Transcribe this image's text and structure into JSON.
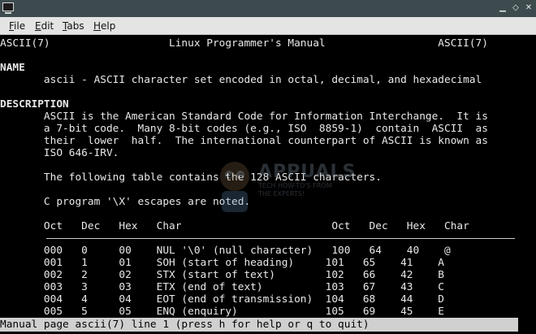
{
  "menubar": {
    "items": [
      {
        "mnemonic": "F",
        "rest": "ile"
      },
      {
        "mnemonic": "E",
        "rest": "dit"
      },
      {
        "mnemonic": "T",
        "rest": "abs"
      },
      {
        "mnemonic": "H",
        "rest": "elp"
      }
    ]
  },
  "titlebar": {
    "controls": [
      "▁",
      "◇",
      "✕"
    ]
  },
  "watermark": {
    "title": "APPUALS",
    "subtitle_1": "TECH HOW-TO'S FROM",
    "subtitle_2": "THE EXPERTS!"
  },
  "man": {
    "header": "ASCII(7)                   Linux Programmer's Manual                  ASCII(7)",
    "name_heading": "NAME",
    "name_text": "       ascii - ASCII character set encoded in octal, decimal, and hexadecimal",
    "description_heading": "DESCRIPTION",
    "description_lines": [
      "       ASCII is the American Standard Code for Information Interchange.  It is",
      "       a 7-bit code.  Many 8-bit codes (e.g., ISO  8859-1)  contain  ASCII  as",
      "       their  lower  half.  The international counterpart of ASCII is known as",
      "       ISO 646-IRV."
    ],
    "table_intro": "       The following table contains the 128 ASCII characters.",
    "escapes_note": "       C program '\\X' escapes are noted.",
    "table_header": "       Oct   Dec   Hex   Char                        Oct   Dec   Hex   Char",
    "table_rows": [
      "       000   0     00    NUL '\\0' (null character)   100   64    40    @",
      "       001   1     01    SOH (start of heading)     101   65    41    A",
      "       002   2     02    STX (start of text)        102   66    42    B",
      "       003   3     03    ETX (end of text)          103   67    43    C",
      "       004   4     04    EOT (end of transmission)  104   68    44    D",
      "       005   5     05    ENQ (enquiry)              105   69    45    E"
    ],
    "status": "Manual page ascii(7) line 1 (press h for help or q to quit)"
  }
}
